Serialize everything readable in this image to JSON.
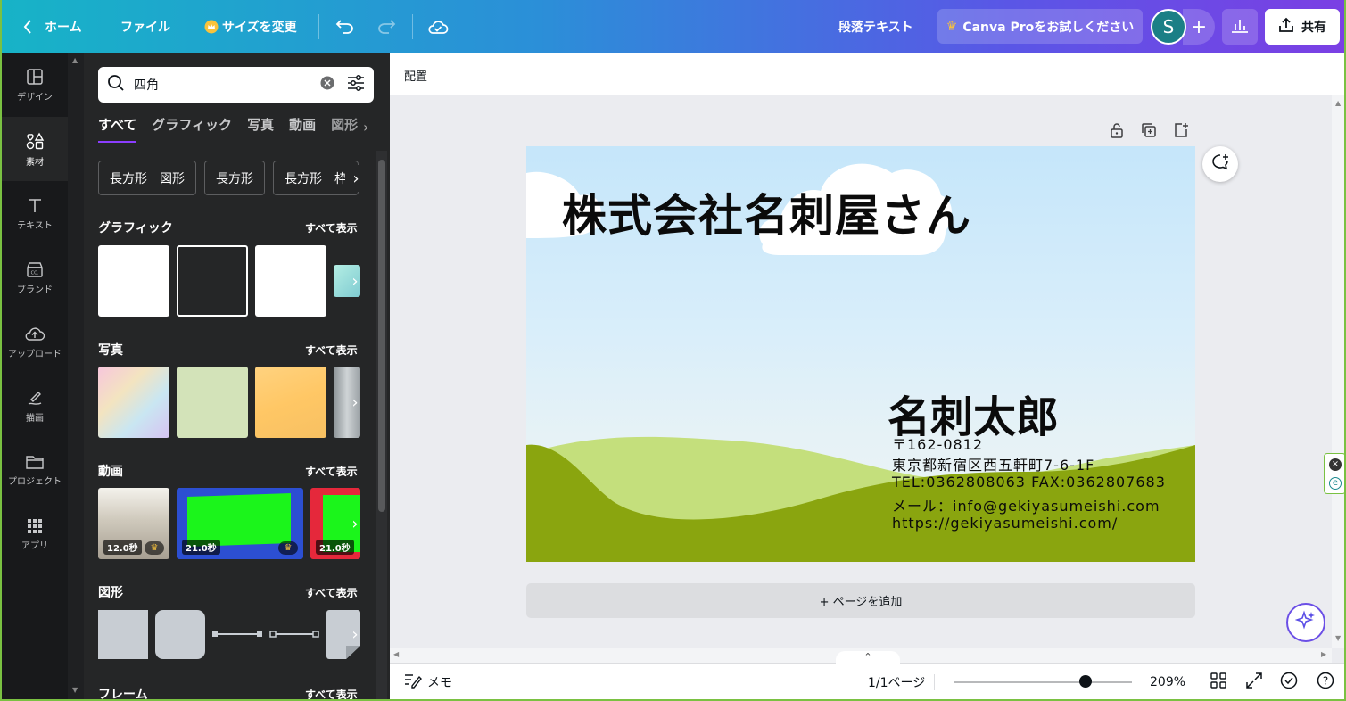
{
  "topbar": {
    "home_label": "ホーム",
    "file_label": "ファイル",
    "resize_label": "サイズを変更",
    "element_name": "段落テキスト",
    "pro_label": "Canva Proをお試しください",
    "avatar_initial": "S",
    "share_label": "共有"
  },
  "rail": {
    "items": [
      {
        "label": "デザイン",
        "icon": "layout-icon"
      },
      {
        "label": "素材",
        "icon": "elements-icon"
      },
      {
        "label": "テキスト",
        "icon": "text-icon"
      },
      {
        "label": "ブランド",
        "icon": "brand-icon"
      },
      {
        "label": "アップロード",
        "icon": "upload-icon"
      },
      {
        "label": "描画",
        "icon": "draw-icon"
      },
      {
        "label": "プロジェクト",
        "icon": "folder-icon"
      },
      {
        "label": "アプリ",
        "icon": "apps-icon"
      }
    ]
  },
  "panel": {
    "search_value": "四角",
    "tabs": [
      "すべて",
      "グラフィック",
      "写真",
      "動画",
      "図形"
    ],
    "chips": [
      "長方形　図形",
      "長方形",
      "長方形　枠"
    ],
    "see_all": "すべて表示",
    "sections": {
      "graphics": "グラフィック",
      "photos": "写真",
      "videos": "動画",
      "shapes": "図形",
      "frames": "フレーム"
    },
    "videos": [
      {
        "duration": "12.0秒"
      },
      {
        "duration": "21.0秒"
      },
      {
        "duration": "21.0秒"
      }
    ]
  },
  "editor": {
    "context_label": "配置",
    "add_page_label": "+ ページを追加"
  },
  "card": {
    "company": "株式会社名刺屋さん",
    "name": "名刺太郎",
    "postal": "〒162-0812",
    "address": "東京都新宿区西五軒町7-6-1F",
    "tel_fax": "TEL:0362808063 FAX:0362807683",
    "email": "メール：info@gekiyasumeishi.com",
    "url": "https://gekiyasumeishi.com/"
  },
  "footer": {
    "notes_label": "メモ",
    "page_indicator": "1/1ページ",
    "zoom": "209%",
    "zoom_fraction": 0.74
  },
  "colors": {
    "accent": "#8b3dff",
    "hill_front": "#8aa50f",
    "hill_back": "#c4df7c"
  }
}
